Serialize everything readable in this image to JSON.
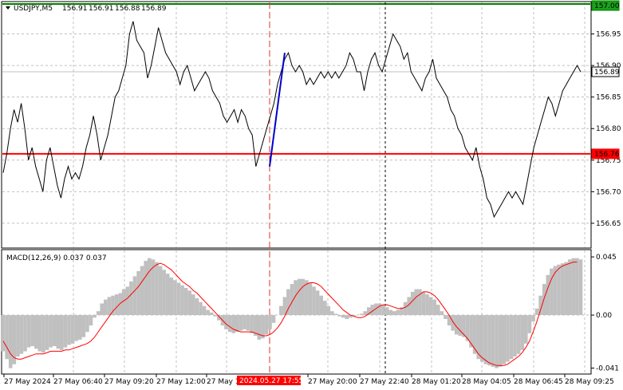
{
  "chart_data": [
    {
      "type": "line",
      "symbol": "USDJPY,M5",
      "ohlc": {
        "open": "156.91",
        "high": "156.91",
        "low": "156.88",
        "close": "156.89"
      },
      "ylim": [
        156.612,
        157.0
      ],
      "y_ticks": [
        "156.95",
        "156.90",
        "156.85",
        "156.80",
        "156.75",
        "156.70",
        "156.65"
      ],
      "price_tags": {
        "top_level": {
          "text": "157.00",
          "value": 157.0,
          "color": "#008000",
          "fill": "#1aa11a"
        },
        "current": {
          "text": "156.89",
          "value": 156.89,
          "color": "#000000",
          "fill": "#ffffff"
        },
        "support": {
          "text": "156.76",
          "value": 156.76,
          "color": "#ff0000",
          "fill": "#ff0000"
        }
      },
      "series": [
        {
          "name": "close",
          "color": "#000000",
          "values": [
            156.73,
            156.76,
            156.8,
            156.83,
            156.81,
            156.84,
            156.8,
            156.75,
            156.77,
            156.74,
            156.72,
            156.7,
            156.75,
            156.77,
            156.74,
            156.71,
            156.69,
            156.72,
            156.74,
            156.72,
            156.73,
            156.72,
            156.74,
            156.77,
            156.79,
            156.82,
            156.79,
            156.75,
            156.77,
            156.79,
            156.82,
            156.85,
            156.86,
            156.88,
            156.9,
            156.95,
            156.97,
            156.94,
            156.93,
            156.92,
            156.88,
            156.9,
            156.93,
            156.96,
            156.94,
            156.92,
            156.91,
            156.9,
            156.89,
            156.87,
            156.89,
            156.9,
            156.88,
            156.86,
            156.87,
            156.88,
            156.89,
            156.88,
            156.86,
            156.85,
            156.84,
            156.82,
            156.81,
            156.82,
            156.83,
            156.81,
            156.83,
            156.82,
            156.8,
            156.79,
            156.74,
            156.76,
            156.78,
            156.8,
            156.82,
            156.84,
            156.87,
            156.89,
            156.91,
            156.92,
            156.9,
            156.89,
            156.9,
            156.89,
            156.87,
            156.88,
            156.87,
            156.88,
            156.89,
            156.88,
            156.89,
            156.88,
            156.89,
            156.88,
            156.89,
            156.9,
            156.92,
            156.91,
            156.89,
            156.89,
            156.86,
            156.89,
            156.91,
            156.92,
            156.9,
            156.89,
            156.91,
            156.93,
            156.95,
            156.94,
            156.93,
            156.91,
            156.92,
            156.89,
            156.88,
            156.87,
            156.86,
            156.88,
            156.89,
            156.91,
            156.88,
            156.87,
            156.86,
            156.85,
            156.83,
            156.82,
            156.8,
            156.79,
            156.77,
            156.76,
            156.75,
            156.77,
            156.74,
            156.72,
            156.69,
            156.68,
            156.66,
            156.67,
            156.68,
            156.69,
            156.7,
            156.69,
            156.7,
            156.69,
            156.68,
            156.71,
            156.74,
            156.77,
            156.79,
            156.81,
            156.83,
            156.85,
            156.84,
            156.82,
            156.84,
            156.86,
            156.87,
            156.88,
            156.89,
            156.9,
            156.89
          ]
        }
      ],
      "annotations": [
        {
          "type": "trendline",
          "from": {
            "xlabel": "2024.05.27 17:55",
            "y": 156.74
          },
          "to": {
            "index": 78,
            "y": 156.92
          },
          "color": "#0000cc"
        }
      ]
    },
    {
      "type": "bar",
      "title": "MACD(12,26,9) 0.037 0.037",
      "ylim": [
        -0.045,
        0.05
      ],
      "y_ticks": [
        "0.045",
        "0.00",
        "-0.041"
      ],
      "series": [
        {
          "name": "main",
          "color": "#c0c0c0",
          "values": [
            -0.028,
            -0.034,
            -0.041,
            -0.038,
            -0.032,
            -0.03,
            -0.028,
            -0.025,
            -0.024,
            -0.026,
            -0.028,
            -0.029,
            -0.027,
            -0.025,
            -0.024,
            -0.026,
            -0.027,
            -0.025,
            -0.023,
            -0.022,
            -0.02,
            -0.019,
            -0.017,
            -0.013,
            -0.008,
            -0.002,
            0.003,
            0.009,
            0.012,
            0.014,
            0.015,
            0.016,
            0.017,
            0.02,
            0.022,
            0.026,
            0.03,
            0.034,
            0.038,
            0.042,
            0.044,
            0.043,
            0.041,
            0.038,
            0.035,
            0.032,
            0.029,
            0.027,
            0.025,
            0.023,
            0.021,
            0.019,
            0.016,
            0.013,
            0.01,
            0.007,
            0.004,
            0.002,
            -0.001,
            -0.004,
            -0.008,
            -0.011,
            -0.013,
            -0.014,
            -0.013,
            -0.012,
            -0.011,
            -0.012,
            -0.014,
            -0.016,
            -0.019,
            -0.018,
            -0.015,
            -0.011,
            -0.006,
            0.0,
            0.007,
            0.014,
            0.02,
            0.024,
            0.027,
            0.028,
            0.028,
            0.027,
            0.025,
            0.022,
            0.019,
            0.015,
            0.011,
            0.007,
            0.003,
            0.001,
            -0.001,
            -0.002,
            -0.003,
            -0.002,
            -0.001,
            0.0,
            0.001,
            0.003,
            0.006,
            0.008,
            0.009,
            0.009,
            0.008,
            0.006,
            0.004,
            0.003,
            0.004,
            0.006,
            0.01,
            0.014,
            0.018,
            0.02,
            0.02,
            0.018,
            0.016,
            0.014,
            0.012,
            0.008,
            0.003,
            -0.003,
            -0.008,
            -0.012,
            -0.015,
            -0.016,
            -0.017,
            -0.02,
            -0.025,
            -0.03,
            -0.034,
            -0.036,
            -0.038,
            -0.039,
            -0.04,
            -0.041,
            -0.04,
            -0.038,
            -0.036,
            -0.034,
            -0.032,
            -0.03,
            -0.027,
            -0.022,
            -0.014,
            -0.005,
            0.005,
            0.015,
            0.024,
            0.031,
            0.036,
            0.038,
            0.039,
            0.04,
            0.041,
            0.043,
            0.044,
            0.044,
            0.043
          ]
        },
        {
          "name": "signal",
          "color": "#ff0000",
          "values": [
            -0.02,
            -0.025,
            -0.03,
            -0.033,
            -0.034,
            -0.034,
            -0.033,
            -0.032,
            -0.031,
            -0.03,
            -0.03,
            -0.03,
            -0.029,
            -0.028,
            -0.028,
            -0.028,
            -0.028,
            -0.027,
            -0.027,
            -0.026,
            -0.025,
            -0.024,
            -0.023,
            -0.022,
            -0.02,
            -0.017,
            -0.013,
            -0.009,
            -0.005,
            -0.001,
            0.003,
            0.006,
            0.009,
            0.011,
            0.013,
            0.016,
            0.019,
            0.022,
            0.026,
            0.03,
            0.034,
            0.037,
            0.039,
            0.04,
            0.039,
            0.037,
            0.035,
            0.032,
            0.029,
            0.026,
            0.024,
            0.022,
            0.019,
            0.017,
            0.014,
            0.011,
            0.008,
            0.005,
            0.002,
            -0.001,
            -0.004,
            -0.007,
            -0.009,
            -0.011,
            -0.012,
            -0.013,
            -0.013,
            -0.013,
            -0.013,
            -0.014,
            -0.015,
            -0.016,
            -0.016,
            -0.015,
            -0.013,
            -0.01,
            -0.006,
            -0.001,
            0.005,
            0.01,
            0.015,
            0.019,
            0.022,
            0.024,
            0.025,
            0.025,
            0.024,
            0.022,
            0.019,
            0.016,
            0.013,
            0.01,
            0.007,
            0.004,
            0.002,
            0.0,
            -0.001,
            -0.002,
            -0.002,
            -0.001,
            0.001,
            0.003,
            0.005,
            0.007,
            0.008,
            0.008,
            0.007,
            0.006,
            0.005,
            0.005,
            0.006,
            0.008,
            0.011,
            0.014,
            0.016,
            0.018,
            0.018,
            0.017,
            0.015,
            0.012,
            0.008,
            0.004,
            0.0,
            -0.005,
            -0.009,
            -0.012,
            -0.015,
            -0.018,
            -0.022,
            -0.026,
            -0.03,
            -0.033,
            -0.035,
            -0.037,
            -0.038,
            -0.039,
            -0.039,
            -0.039,
            -0.038,
            -0.036,
            -0.034,
            -0.032,
            -0.029,
            -0.025,
            -0.02,
            -0.013,
            -0.005,
            0.004,
            0.013,
            0.021,
            0.028,
            0.033,
            0.036,
            0.038,
            0.039,
            0.04,
            0.041,
            0.041
          ]
        }
      ]
    }
  ],
  "x_axis": {
    "labels": [
      "27 May 2024",
      "27 May 06:40",
      "27 May 09:20",
      "27 May 12:00",
      "27 May 1",
      "27 May 20:00",
      "27 May 22:40",
      "28 May 01:20",
      "28 May 04:05",
      "28 May 06:45",
      "28 May 09:25"
    ],
    "highlight_label": "2024.05.27 17:55",
    "highlight_color": "#ff0000"
  }
}
